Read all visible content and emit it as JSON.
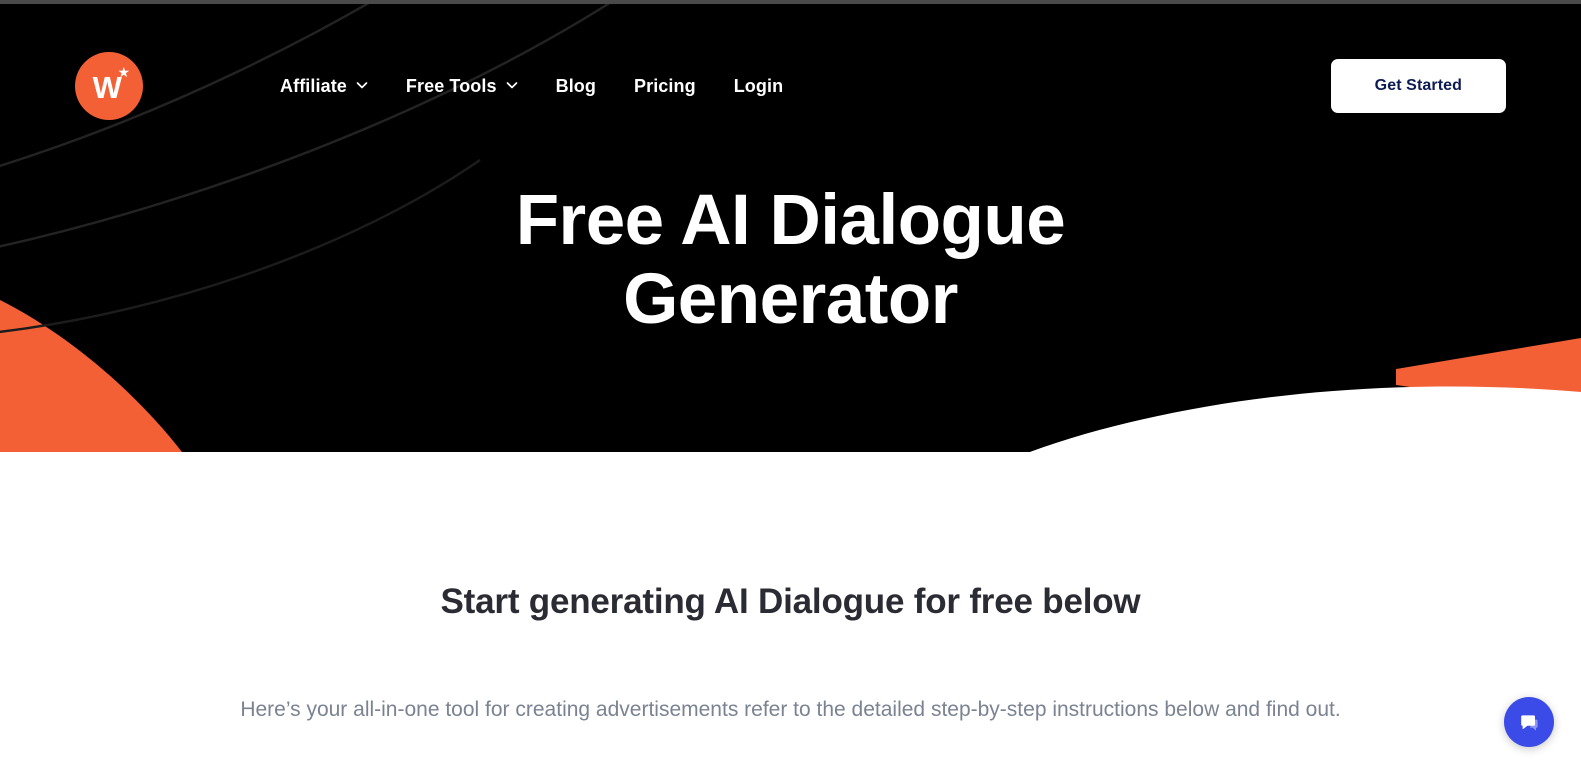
{
  "brand": {
    "logo_letter": "W",
    "logo_star": "★",
    "accent_color": "#F46036",
    "dark_color": "#000000",
    "cta_text_color": "#0d1b54"
  },
  "nav": {
    "items": [
      {
        "label": "Affiliate",
        "has_dropdown": true,
        "icon": "chevron-down-icon"
      },
      {
        "label": "Free Tools",
        "has_dropdown": true,
        "icon": "chevron-down-icon"
      },
      {
        "label": "Blog",
        "has_dropdown": false,
        "icon": ""
      },
      {
        "label": "Pricing",
        "has_dropdown": false,
        "icon": ""
      },
      {
        "label": "Login",
        "has_dropdown": false,
        "icon": ""
      }
    ],
    "cta_label": "Get Started"
  },
  "hero": {
    "title": "Free AI Dialogue Generator",
    "title_line_1": "Free AI Dialogue",
    "title_line_2": "Generator",
    "background_color": "#000000",
    "accent_shape_color": "#F46036"
  },
  "main": {
    "heading": "Start generating AI Dialogue for free below",
    "subheading": "Here’s your all-in-one tool for creating advertisements refer to the detailed step-by-step instructions below and find out.",
    "heading_color": "#2b2b33",
    "subheading_color": "#7b8392"
  },
  "chat": {
    "icon": "chat-bubble-icon",
    "color": "#3B4BE8"
  }
}
